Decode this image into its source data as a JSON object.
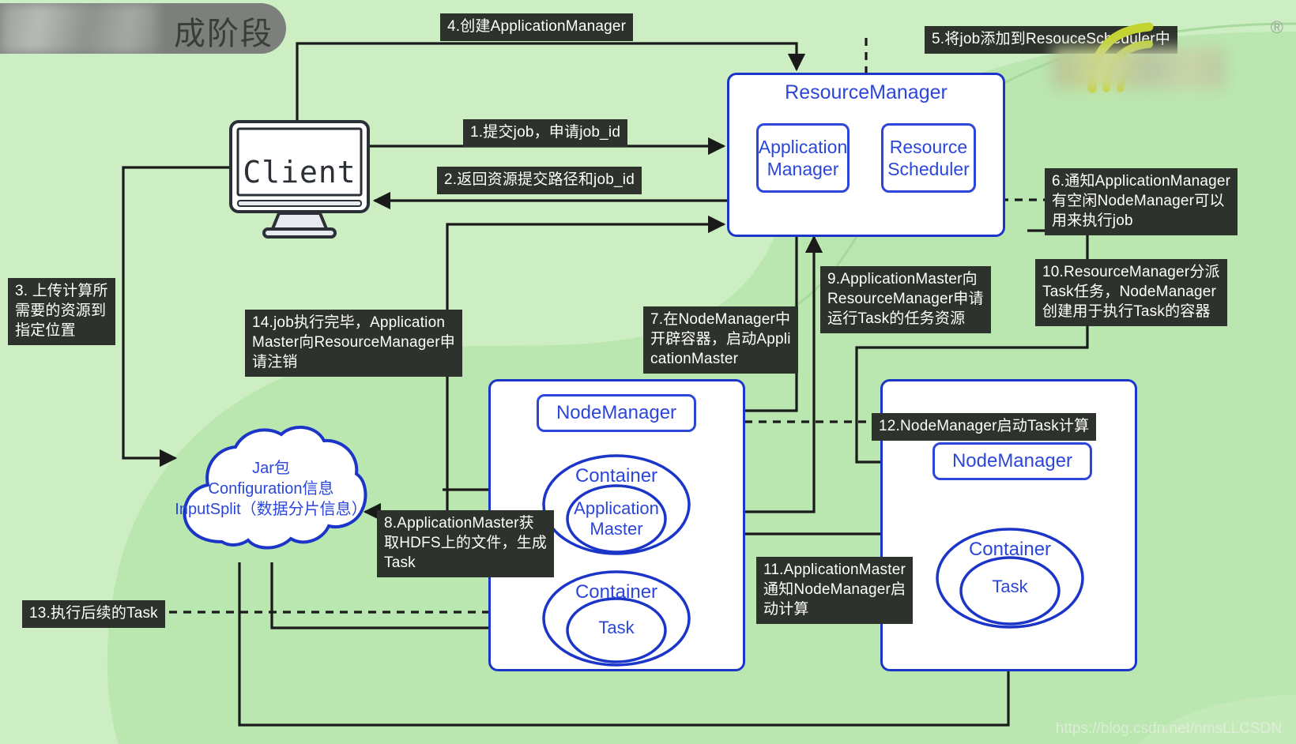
{
  "page": {
    "title_pill": "成阶段",
    "watermark_url": "https://blog.csdn.net/nmsLLCSDN",
    "registered_mark": "®",
    "bg_color": "#cdeec2",
    "blob_color": "#b5e3ab",
    "accent_blue": "#2b46d9",
    "label_bg": "#2e322c"
  },
  "nodes": {
    "client": {
      "label": "Client"
    },
    "resource_manager": {
      "title": "ResourceManager",
      "children": [
        {
          "label": "Application\nManager"
        },
        {
          "label": "Resource\nScheduler"
        }
      ]
    },
    "cloud": {
      "line1": "Jar包",
      "line2": "Configuration信息",
      "line3": "InputSplit（数据分片信息）"
    },
    "node_manager_left": {
      "title": "NodeManager",
      "containers": [
        {
          "outer": "Container",
          "inner": "Application\nMaster"
        },
        {
          "outer": "Container",
          "inner": "Task"
        }
      ]
    },
    "node_manager_right": {
      "title": "NodeManager",
      "containers": [
        {
          "outer": "Container",
          "inner": "Task"
        }
      ]
    }
  },
  "steps": [
    {
      "id": 1,
      "text": "1.提交job，申请job_id"
    },
    {
      "id": 2,
      "text": "2.返回资源提交路径和job_id"
    },
    {
      "id": 3,
      "text": "3. 上传计算所\n需要的资源到\n指定位置"
    },
    {
      "id": 4,
      "text": "4.创建ApplicationManager"
    },
    {
      "id": 5,
      "text": "5.将job添加到ResouceScheduler中"
    },
    {
      "id": 6,
      "text": "6.通知ApplicationManager\n有空闲NodeManager可以\n用来执行job"
    },
    {
      "id": 7,
      "text": "7.在NodeManager中\n开辟容器，启动Appli\ncationMaster"
    },
    {
      "id": 8,
      "text": "8.ApplicationMaster获\n取HDFS上的文件，生成\nTask"
    },
    {
      "id": 9,
      "text": "9.ApplicationMaster向\nResourceManager申请\n运行Task的任务资源"
    },
    {
      "id": 10,
      "text": "10.ResourceManager分派\nTask任务，NodeManager\n创建用于执行Task的容器"
    },
    {
      "id": 11,
      "text": "11.ApplicationMaster\n通知NodeManager启\n动计算"
    },
    {
      "id": 12,
      "text": "12.NodeManager启动Task计算"
    },
    {
      "id": 13,
      "text": "13.执行后续的Task"
    },
    {
      "id": 14,
      "text": "14.job执行完毕，Application\nMaster向ResourceManager申\n请注销"
    }
  ]
}
